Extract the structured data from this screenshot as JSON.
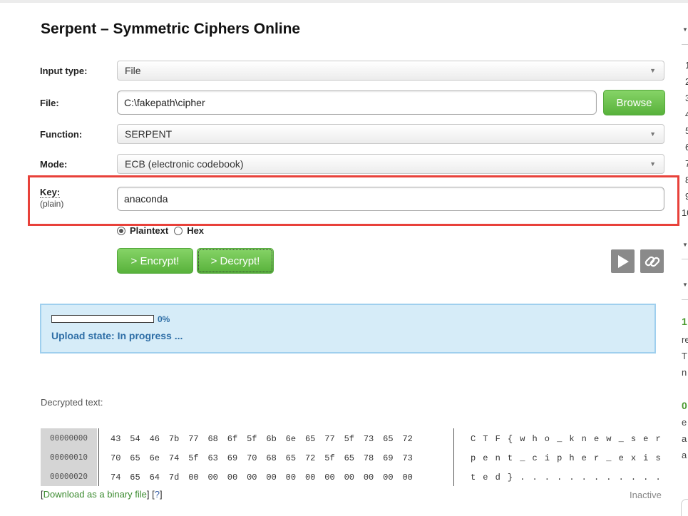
{
  "page": {
    "title": "Serpent – Symmetric Ciphers Online"
  },
  "form": {
    "input_type": {
      "label": "Input type:",
      "value": "File"
    },
    "file": {
      "label": "File:",
      "value": "C:\\fakepath\\cipher",
      "browse_label": "Browse"
    },
    "function": {
      "label": "Function:",
      "value": "SERPENT"
    },
    "mode": {
      "label": "Mode:",
      "value": "ECB (electronic codebook)"
    },
    "key": {
      "label": "Key:",
      "sublabel": "(plain)",
      "value": "anaconda"
    },
    "key_format": {
      "options": [
        "Plaintext",
        "Hex"
      ],
      "selected": "Plaintext"
    },
    "encrypt_label": "> Encrypt!",
    "decrypt_label": "> Decrypt!"
  },
  "icons": {
    "play": "play-icon",
    "link": "link-icon"
  },
  "upload": {
    "progress_percent": 0,
    "percent_text": "0%",
    "state_text": "Upload state: In progress ..."
  },
  "output": {
    "label": "Decrypted text:",
    "rows": [
      {
        "offset": "00000000",
        "bytes": [
          "43",
          "54",
          "46",
          "7b",
          "77",
          "68",
          "6f",
          "5f",
          "6b",
          "6e",
          "65",
          "77",
          "5f",
          "73",
          "65",
          "72"
        ],
        "ascii": [
          "C",
          "T",
          "F",
          "{",
          "w",
          "h",
          "o",
          "_",
          "k",
          "n",
          "e",
          "w",
          "_",
          "s",
          "e",
          "r"
        ]
      },
      {
        "offset": "00000010",
        "bytes": [
          "70",
          "65",
          "6e",
          "74",
          "5f",
          "63",
          "69",
          "70",
          "68",
          "65",
          "72",
          "5f",
          "65",
          "78",
          "69",
          "73"
        ],
        "ascii": [
          "p",
          "e",
          "n",
          "t",
          "_",
          "c",
          "i",
          "p",
          "h",
          "e",
          "r",
          "_",
          "e",
          "x",
          "i",
          "s"
        ]
      },
      {
        "offset": "00000020",
        "bytes": [
          "74",
          "65",
          "64",
          "7d",
          "00",
          "00",
          "00",
          "00",
          "00",
          "00",
          "00",
          "00",
          "00",
          "00",
          "00",
          "00"
        ],
        "ascii": [
          "t",
          "e",
          "d",
          "}",
          ".",
          ".",
          ".",
          ".",
          ".",
          ".",
          ".",
          ".",
          ".",
          ".",
          ".",
          "."
        ]
      }
    ],
    "download_label": "Download as a binary file",
    "help_label": "?",
    "status": "Inactive"
  },
  "sidebar": {
    "numbers": [
      "1",
      "2",
      "3",
      "4",
      "5",
      "6",
      "7",
      "8",
      "9",
      "10"
    ],
    "item1_title": "1",
    "item1_lines": [
      "re",
      "T",
      "n"
    ],
    "item2_title": "0",
    "item2_lines": [
      "e",
      "a",
      "a"
    ]
  },
  "colors": {
    "accent_green": "#58b23b",
    "highlight_red": "#e8413a",
    "info_blue": "#2e6ea6",
    "info_bg": "#d6ecf8"
  }
}
